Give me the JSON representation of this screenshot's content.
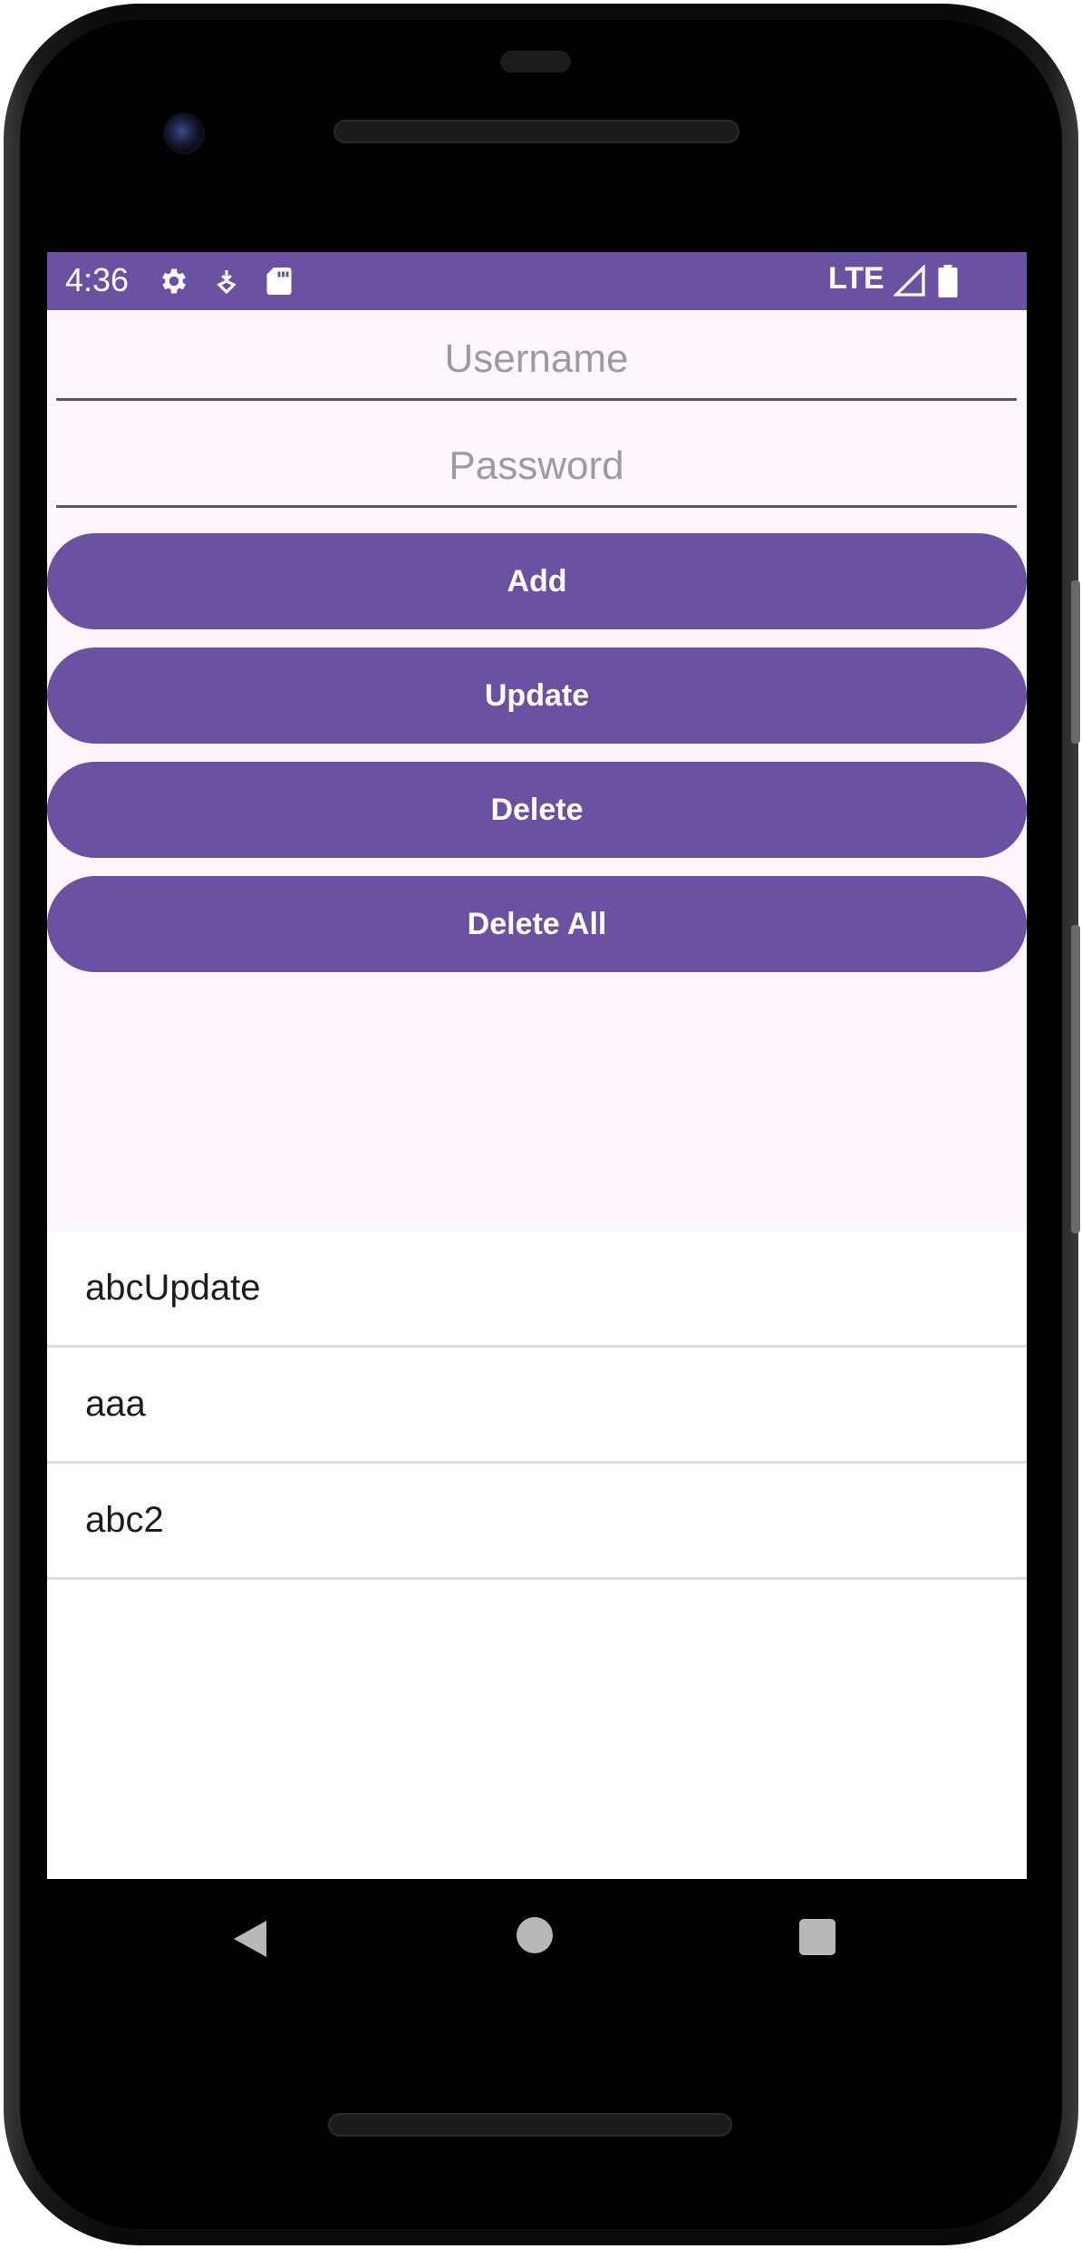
{
  "status_bar": {
    "time": "4:36",
    "network": "LTE",
    "icons": [
      "gear-icon",
      "download-icon",
      "sd-card-icon",
      "signal-icon",
      "battery-icon"
    ]
  },
  "form": {
    "username_placeholder": "Username",
    "password_placeholder": "Password"
  },
  "buttons": {
    "add": "Add",
    "update": "Update",
    "delete": "Delete",
    "delete_all": "Delete All"
  },
  "list": {
    "items": [
      "abcUpdate",
      "aaa",
      "abc2"
    ]
  },
  "colors": {
    "primary": "#6a51a2",
    "form_background": "#fdf7fd",
    "divider": "#dcdcdc"
  }
}
